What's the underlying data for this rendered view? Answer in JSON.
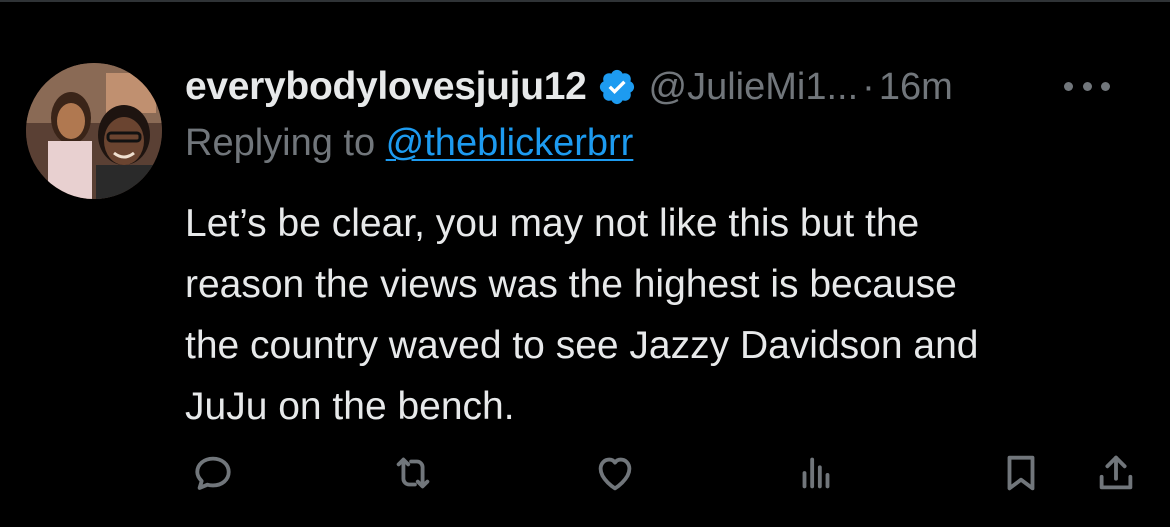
{
  "tweet": {
    "display_name": "everybodylovesjuju12",
    "handle": "@JulieMi1...",
    "separator": "·",
    "time": "16m",
    "replying_prefix": "Replying to ",
    "replying_to": "@theblickerbrr",
    "body_lines": [
      "Let’s be clear, you may not like this but the",
      "reason the views was the highest is because",
      "the country waved to see Jazzy Davidson and",
      "JuJu on the bench."
    ]
  },
  "actions": [
    {
      "name": "reply",
      "icon": "speech-bubble-icon"
    },
    {
      "name": "repost",
      "icon": "repost-arrows-icon"
    },
    {
      "name": "like",
      "icon": "heart-icon"
    },
    {
      "name": "views",
      "icon": "bar-chart-icon"
    },
    {
      "name": "bookmark",
      "icon": "bookmark-icon"
    },
    {
      "name": "share",
      "icon": "share-upload-icon"
    }
  ],
  "colors": {
    "background": "#000000",
    "text": "#e7e9ea",
    "muted": "#71767b",
    "link": "#1d9bf0",
    "verified": "#1d9bf0"
  }
}
